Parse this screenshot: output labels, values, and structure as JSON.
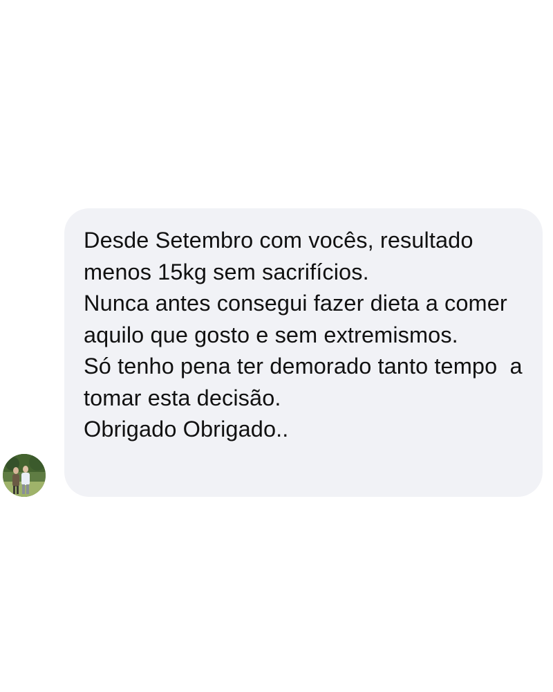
{
  "message": {
    "paragraphs": [
      "Desde Setembro com vocês, resultado menos 15kg sem sacrifícios.",
      "Nunca antes consegui fazer dieta a comer aquilo que gosto e sem extremismos.",
      "Só tenho pena ter demorado tanto tempo  a tomar esta decisão.",
      "Obrigado Obrigado.."
    ]
  },
  "colors": {
    "bubble_background": "#f1f2f6",
    "text": "#111111",
    "page_background": "#ffffff"
  }
}
